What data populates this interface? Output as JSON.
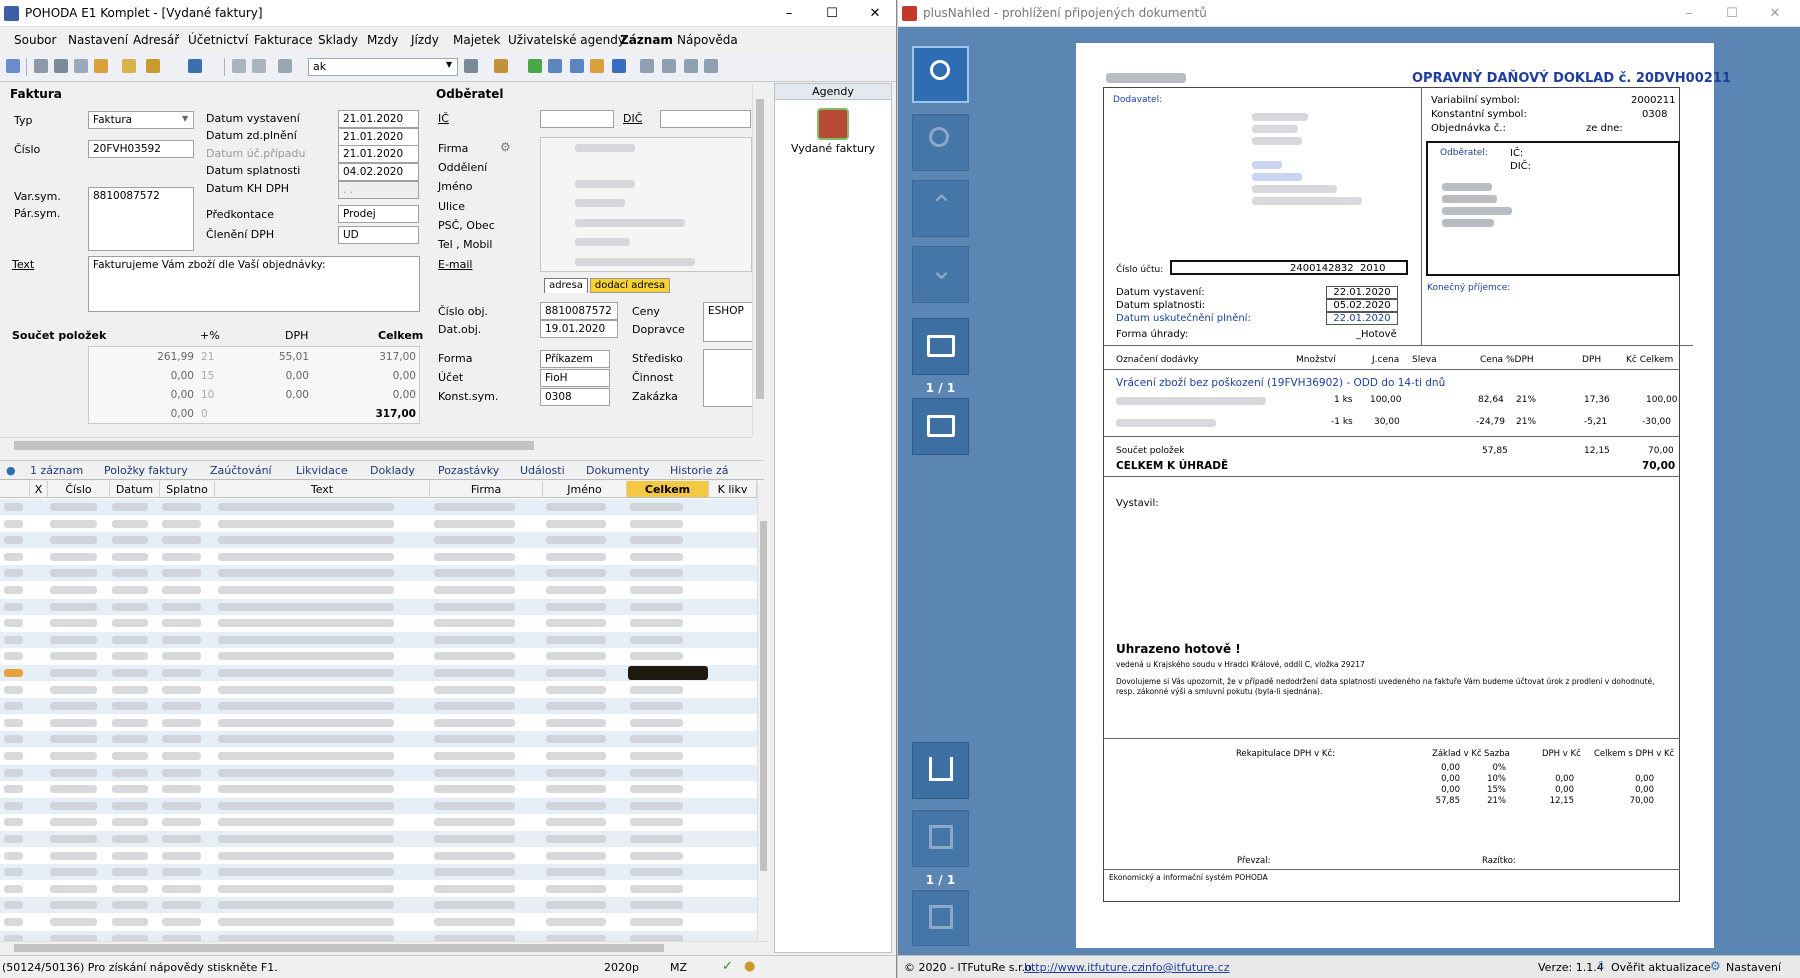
{
  "left": {
    "title": "POHODA E1 Komplet - [Vydané faktury]",
    "menu": [
      "Soubor",
      "Nastavení",
      "Adresář",
      "Účetnictví",
      "Fakturace",
      "Sklady",
      "Mzdy",
      "Jízdy",
      "Majetek",
      "Uživatelské agendy",
      "Záznam",
      "Nápověda"
    ],
    "search_value": "ak",
    "faktura": {
      "section": "Faktura",
      "typ_label": "Typ",
      "typ_value": "Faktura",
      "cislo_label": "Číslo",
      "cislo_value": "20FVH03592",
      "varsym_label": "Var.sym.",
      "varsym_value": "8810087572",
      "parsym_label": "Pár.sym.",
      "datum_vystaveni_label": "Datum vystavení",
      "datum_vystaveni": "21.01.2020",
      "datum_zdplneni_label": "Datum zd.plnění",
      "datum_zdplneni": "21.01.2020",
      "datum_ucpripadu_label": "Datum úč.případu",
      "datum_ucpripadu": "21.01.2020",
      "datum_splatnosti_label": "Datum splatnosti",
      "datum_splatnosti": "04.02.2020",
      "datum_khdph_label": "Datum KH DPH",
      "datum_khdph": ". .",
      "predkontace_label": "Předkontace",
      "predkontace": "Prodej",
      "cleneni_label": "Členění DPH",
      "cleneni": "UD",
      "text_label": "Text",
      "text_value": "Fakturujeme Vám zboží dle Vaší objednávky:"
    },
    "soucet": {
      "title": "Součet položek",
      "h_pct": "+%",
      "h_dph": "DPH",
      "h_celkem": "Celkem",
      "rows": [
        {
          "zaklad": "261,99",
          "pct": "21",
          "dph": "55,01",
          "celkem": "317,00"
        },
        {
          "zaklad": "0,00",
          "pct": "15",
          "dph": "0,00",
          "celkem": "0,00"
        },
        {
          "zaklad": "0,00",
          "pct": "10",
          "dph": "0,00",
          "celkem": "0,00"
        },
        {
          "zaklad": "0,00",
          "pct": "0",
          "dph": "",
          "celkem": "317,00"
        }
      ]
    },
    "odberatel": {
      "section": "Odběratel",
      "ic": "IČ",
      "dic": "DIČ",
      "firma": "Firma",
      "oddeleni": "Oddělení",
      "jmeno": "Jméno",
      "ulice": "Ulice",
      "psc": "PSČ, Obec",
      "tel": "Tel , Mobil",
      "email": "E-mail",
      "tab_adresa": "adresa",
      "tab_dodaci": "dodací adresa",
      "cislo_obj_label": "Číslo obj.",
      "cislo_obj": "8810087572",
      "datobj_label": "Dat.obj.",
      "datobj": "19.01.2020",
      "ceny_label": "Ceny",
      "ceny": "ESHOP",
      "doprava_label": "Dopravce",
      "forma_label": "Forma",
      "forma": "Příkazem",
      "ucet_label": "Účet",
      "ucet": "FioH",
      "konst_label": "Konst.sym.",
      "konst": "0308",
      "stredisko": "Středisko",
      "cinnost": "Činnost",
      "zakazka": "Zakázka"
    },
    "agendy": {
      "title": "Agendy",
      "item": "Vydané faktury"
    },
    "tabs": [
      "1 záznam",
      "Položky faktury",
      "Zaúčtování",
      "Likvidace",
      "Doklady",
      "Pozastávky",
      "Události",
      "Dokumenty",
      "Historie zá"
    ],
    "grid_headers": [
      "X",
      "Číslo",
      "Datum",
      "Splatno",
      "Text",
      "Firma",
      "Jméno",
      "Celkem",
      "K likv"
    ],
    "status": {
      "help": "(50124/50136) Pro získání nápovědy stiskněte F1.",
      "year": "2020p",
      "user": "MZ"
    }
  },
  "right": {
    "title": "plusNahled - prohlížení připojených dokumentů",
    "page1": "1 / 1",
    "page2": "1 / 1",
    "doc": {
      "heading": "OPRAVNÝ DAŇOVÝ DOKLAD č. 20DVH00211",
      "dodavatel": "Dodavatel:",
      "varsym_label": "Variabilní symbol:",
      "varsym": "2000211",
      "konst_label": "Konstantní symbol:",
      "konst": "0308",
      "obj_label": "Objednávka č.:",
      "ze_dne": "ze dne:",
      "odberatel": "Odběratel:",
      "ic": "IČ:",
      "dic": "DIČ:",
      "cislo_uctu_label": "Číslo účtu:",
      "cislo_uctu": "2400142832",
      "kod_banky": "2010",
      "konecny": "Konečný příjemce:",
      "datum_vystaveni_label": "Datum vystavení:",
      "datum_vystaveni": "22.01.2020",
      "datum_splatnosti_label": "Datum splatnosti:",
      "datum_splatnosti": "05.02.2020",
      "datum_plneni_label": "Datum uskutečnění plnění:",
      "datum_plneni": "22.01.2020",
      "forma_label": "Forma úhrady:",
      "forma": "_Hotově",
      "cols": [
        "Označení dodávky",
        "Množství",
        "J.cena",
        "Sleva",
        "Cena",
        "%DPH",
        "DPH",
        "Kč Celkem"
      ],
      "item_title": "Vrácení zboží bez poškození (19FVH36902) - ODD do 14-ti dnů",
      "rows": [
        {
          "mn": "1 ks",
          "jc": "100,00",
          "cena": "82,64",
          "pct": "21%",
          "dph": "17,36",
          "celkem": "100,00"
        },
        {
          "mn": "-1 ks",
          "jc": "30,00",
          "cena": "-24,79",
          "pct": "21%",
          "dph": "-5,21",
          "celkem": "-30,00"
        }
      ],
      "soucet_label": "Součet položek",
      "soucet_cena": "57,85",
      "soucet_dph": "12,15",
      "soucet_celkem": "70,00",
      "celkem_label": "CELKEM K ÚHRADĚ",
      "celkem": "70,00",
      "vystavil": "Vystavil:",
      "uhrazeno": "Uhrazeno hotově !",
      "vedena": "vedená u Krajského soudu v Hradci Králové, oddíl C, vložka 29217",
      "upozorneni": "Dovolujeme si Vás upozornit, že v případě nedodržení data splatnosti uvedeného na faktuře Vám budeme účtovat úrok z prodlení v dohodnuté, resp. zákonné výši a smluvní pokutu (byla-li sjednána).",
      "rekap_label": "Rekapitulace DPH v Kč:",
      "rekap_cols": [
        "Základ v Kč",
        "Sazba",
        "DPH v Kč",
        "Celkem s DPH v Kč"
      ],
      "rekap": [
        {
          "z": "0,00",
          "s": "0%",
          "d": "",
          "c": ""
        },
        {
          "z": "0,00",
          "s": "10%",
          "d": "0,00",
          "c": "0,00"
        },
        {
          "z": "0,00",
          "s": "15%",
          "d": "0,00",
          "c": "0,00"
        },
        {
          "z": "57,85",
          "s": "21%",
          "d": "12,15",
          "c": "70,00"
        }
      ],
      "prevzal": "Převzal:",
      "razitko": "Razítko:",
      "footer": "Ekonomický a informační systém POHODA"
    },
    "status": {
      "copy": "© 2020 - ITFutuRe s.r.o.",
      "url": "http://www.itfuture.cz",
      "mail": "info@itfuture.cz",
      "verze": "Verze: 1.1.4",
      "overit": "Ověřit aktualizace",
      "nastaveni": "Nastavení"
    }
  },
  "colors": {
    "accent": "#2f6db2",
    "highlight": "#f5c842",
    "docblue": "#1f3e9c"
  }
}
